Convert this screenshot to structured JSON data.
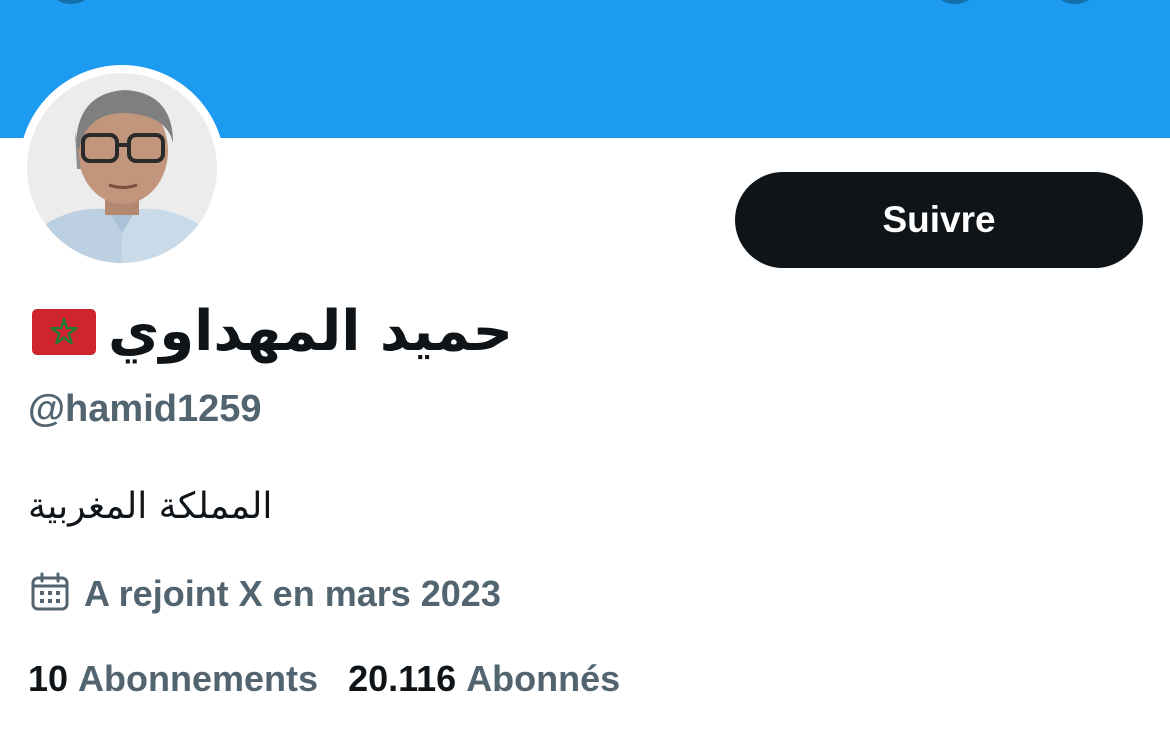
{
  "colors": {
    "banner": "#1d9bf0",
    "text_primary": "#0f1419",
    "text_secondary": "#536471",
    "button_bg": "#0f1419",
    "button_text": "#ffffff"
  },
  "profile": {
    "display_name": "حميد المهداوي",
    "name_emoji": "morocco-flag",
    "handle": "@hamid1259",
    "bio": "المملكة المغربية",
    "joined_icon": "calendar-icon",
    "joined_text": "A rejoint X en mars 2023",
    "following_count": "10",
    "following_label": "Abonnements",
    "followers_count": "20.116",
    "followers_label": "Abonnés"
  },
  "actions": {
    "follow_label": "Suivre"
  }
}
